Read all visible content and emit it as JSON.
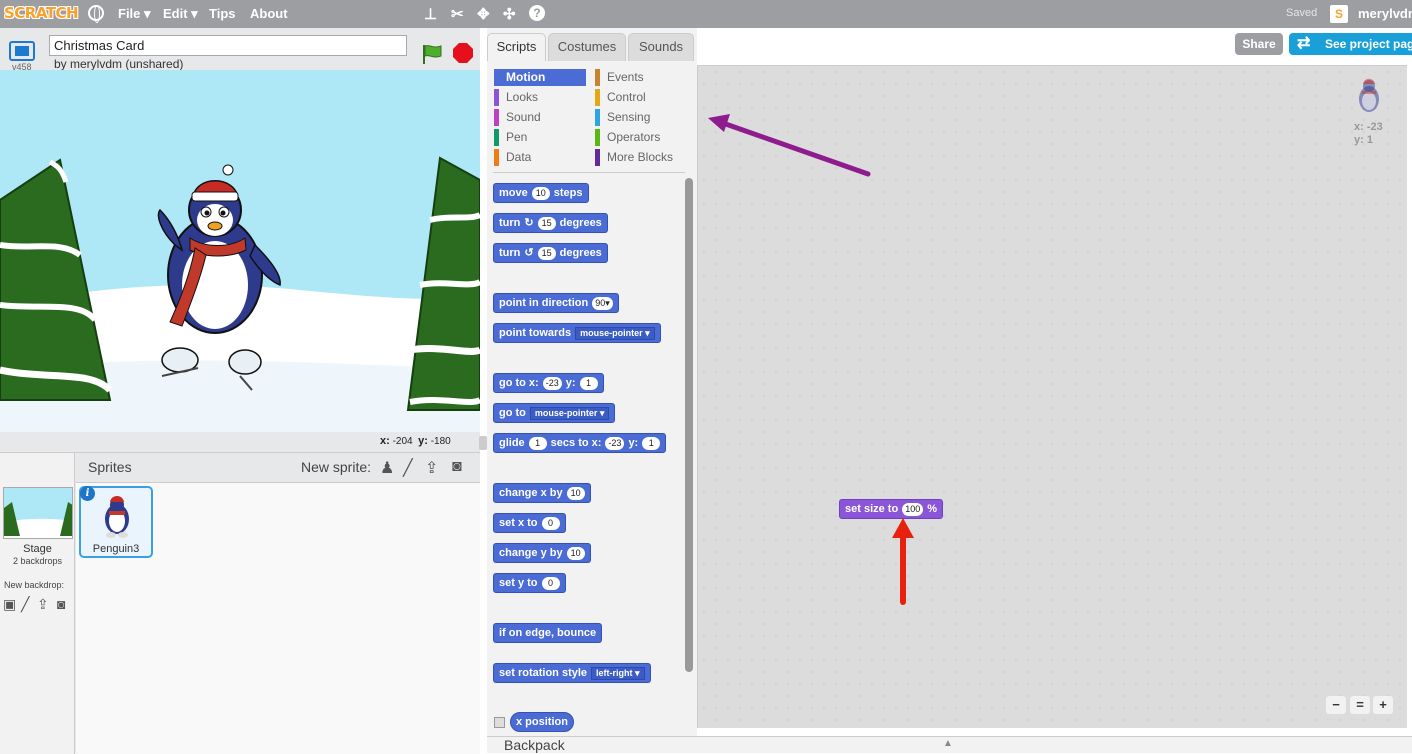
{
  "topbar": {
    "logo": "SCRATCH",
    "menus": [
      "File ▾",
      "Edit ▾",
      "Tips",
      "About"
    ],
    "saved": "Saved",
    "username": "merylvdm"
  },
  "project": {
    "title": "Christmas Card",
    "byline": "by merylvdm (unshared)",
    "version": "v458"
  },
  "stage": {
    "coords_x_label": "x:",
    "coords_x": "-204",
    "coords_y_label": "y:",
    "coords_y": "-180"
  },
  "sprites": {
    "label": "Sprites",
    "new_sprite_label": "New sprite:",
    "stage_name": "Stage",
    "stage_backdrops": "2 backdrops",
    "new_backdrop_label": "New backdrop:",
    "sprite_name": "Penguin3",
    "info_icon": "i"
  },
  "tabs": [
    "Scripts",
    "Costumes",
    "Sounds"
  ],
  "categories": [
    {
      "label": "Motion",
      "color": "#4a6cd4"
    },
    {
      "label": "Looks",
      "color": "#8a55d7"
    },
    {
      "label": "Sound",
      "color": "#bb42c3"
    },
    {
      "label": "Pen",
      "color": "#0e9a6c"
    },
    {
      "label": "Data",
      "color": "#ee7d16"
    },
    {
      "label": "Events",
      "color": "#c88330"
    },
    {
      "label": "Control",
      "color": "#e1a91a"
    },
    {
      "label": "Sensing",
      "color": "#2ca5e2"
    },
    {
      "label": "Operators",
      "color": "#5cb712"
    },
    {
      "label": "More Blocks",
      "color": "#632d99"
    }
  ],
  "blocks": {
    "move": {
      "a": "move",
      "n": "10",
      "b": "steps"
    },
    "turn_right": {
      "a": "turn",
      "n": "15",
      "b": "degrees"
    },
    "turn_left": {
      "a": "turn",
      "n": "15",
      "b": "degrees"
    },
    "point_dir": {
      "a": "point in direction",
      "n": "90▾"
    },
    "point_towards": {
      "a": "point towards",
      "d": "mouse-pointer"
    },
    "goto_xy": {
      "a": "go to x:",
      "x": "-23",
      "b": "y:",
      "y": "1"
    },
    "goto": {
      "a": "go to",
      "d": "mouse-pointer"
    },
    "glide": {
      "a": "glide",
      "n": "1",
      "b": "secs to x:",
      "x": "-23",
      "c": "y:",
      "y": "1"
    },
    "change_x": {
      "a": "change x by",
      "n": "10"
    },
    "set_x": {
      "a": "set x to",
      "n": "0"
    },
    "change_y": {
      "a": "change y by",
      "n": "10"
    },
    "set_y": {
      "a": "set y to",
      "n": "0"
    },
    "bounce": {
      "a": "if on edge, bounce"
    },
    "rotation": {
      "a": "set rotation style",
      "d": "left-right"
    },
    "xpos": {
      "a": "x position"
    }
  },
  "script": {
    "set_size": {
      "a": "set size to",
      "n": "100",
      "b": "%"
    }
  },
  "buttons": {
    "share": "Share",
    "see_project": "See project page"
  },
  "sprite_info": {
    "x": "x: -23",
    "y": "y: 1"
  },
  "zoom": [
    "−",
    "=",
    "+"
  ],
  "backpack": "Backpack"
}
